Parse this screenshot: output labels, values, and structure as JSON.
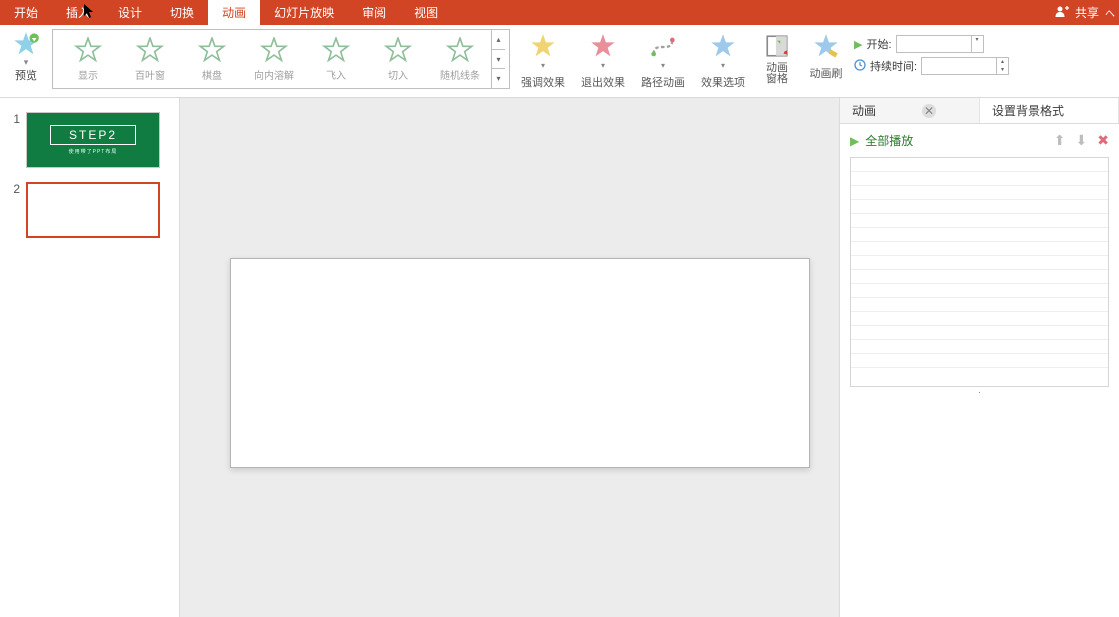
{
  "colors": {
    "brand": "#d14424",
    "green": "#107c41"
  },
  "tabs": {
    "items": [
      "开始",
      "插入",
      "设计",
      "切换",
      "动画",
      "幻灯片放映",
      "审阅",
      "视图"
    ],
    "active_index": 4
  },
  "share": {
    "label": "共享"
  },
  "ribbon": {
    "preview": {
      "label": "预览"
    },
    "gallery_items": [
      {
        "label": "显示"
      },
      {
        "label": "百叶窗"
      },
      {
        "label": "棋盘"
      },
      {
        "label": "向内溶解"
      },
      {
        "label": "飞入"
      },
      {
        "label": "切入"
      },
      {
        "label": "随机线条"
      }
    ],
    "effects": [
      {
        "label": "强调效果",
        "color": "#e6c24d"
      },
      {
        "label": "退出效果",
        "color": "#e06a7a"
      },
      {
        "label": "路径动画",
        "color": "#8f8f8f"
      },
      {
        "label": "效果选项",
        "color": "#6aa9e0"
      }
    ],
    "pane_button": {
      "label1": "动画",
      "label2": "窗格"
    },
    "painter": {
      "label": "动画刷"
    },
    "timing": {
      "start_label": "开始:",
      "duration_label": "持续时间:",
      "start_value": "",
      "duration_value": ""
    }
  },
  "thumbnails": {
    "slides": [
      {
        "num": "1",
        "title": "STEP2",
        "sub": "使用带了PPT布局"
      },
      {
        "num": "2"
      }
    ],
    "selected_index": 1
  },
  "right_panel": {
    "tabs": [
      {
        "label": "动画"
      },
      {
        "label": "设置背景格式"
      }
    ],
    "active_index": 0,
    "play_all_label": "全部播放"
  }
}
